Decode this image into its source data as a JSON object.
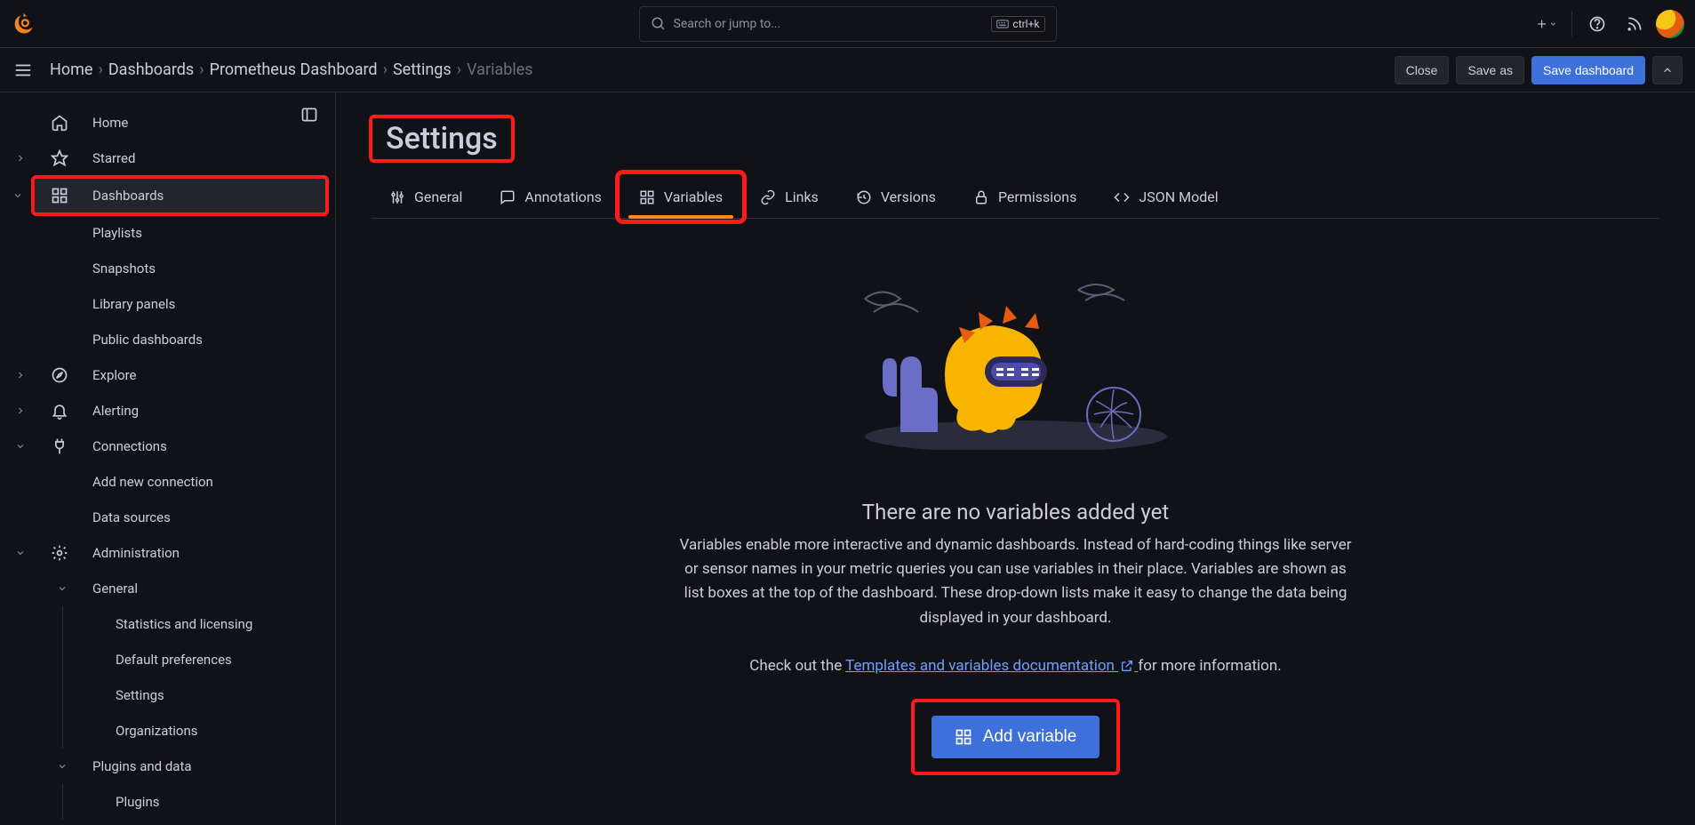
{
  "search": {
    "placeholder": "Search or jump to...",
    "shortcut": "ctrl+k"
  },
  "breadcrumbs": {
    "home": "Home",
    "dashboards": "Dashboards",
    "dashboard_name": "Prometheus Dashboard",
    "settings": "Settings",
    "variables": "Variables"
  },
  "actions": {
    "close": "Close",
    "save_as": "Save as",
    "save_dashboard": "Save dashboard"
  },
  "sidebar": {
    "home": "Home",
    "starred": "Starred",
    "dashboards": "Dashboards",
    "playlists": "Playlists",
    "snapshots": "Snapshots",
    "library_panels": "Library panels",
    "public_dashboards": "Public dashboards",
    "explore": "Explore",
    "alerting": "Alerting",
    "connections": "Connections",
    "add_new_connection": "Add new connection",
    "data_sources": "Data sources",
    "administration": "Administration",
    "general": "General",
    "statistics": "Statistics and licensing",
    "default_preferences": "Default preferences",
    "settings": "Settings",
    "organizations": "Organizations",
    "plugins_and_data": "Plugins and data",
    "plugins": "Plugins"
  },
  "page": {
    "title": "Settings"
  },
  "tabs": {
    "general": "General",
    "annotations": "Annotations",
    "variables": "Variables",
    "links": "Links",
    "versions": "Versions",
    "permissions": "Permissions",
    "json_model": "JSON Model"
  },
  "empty": {
    "title": "There are no variables added yet",
    "desc": "Variables enable more interactive and dynamic dashboards. Instead of hard-coding things like server or sensor names in your metric queries you can use variables in their place. Variables are shown as list boxes at the top of the dashboard. These drop-down lists make it easy to change the data being displayed in your dashboard.",
    "check_prefix": "Check out the ",
    "doc_link": "Templates and variables documentation",
    "check_suffix": " for more information.",
    "add_button": "Add variable"
  },
  "colors": {
    "accent": "#3d71d9",
    "highlight": "#ff1a1a",
    "tab_underline": "#ff8c1a"
  }
}
